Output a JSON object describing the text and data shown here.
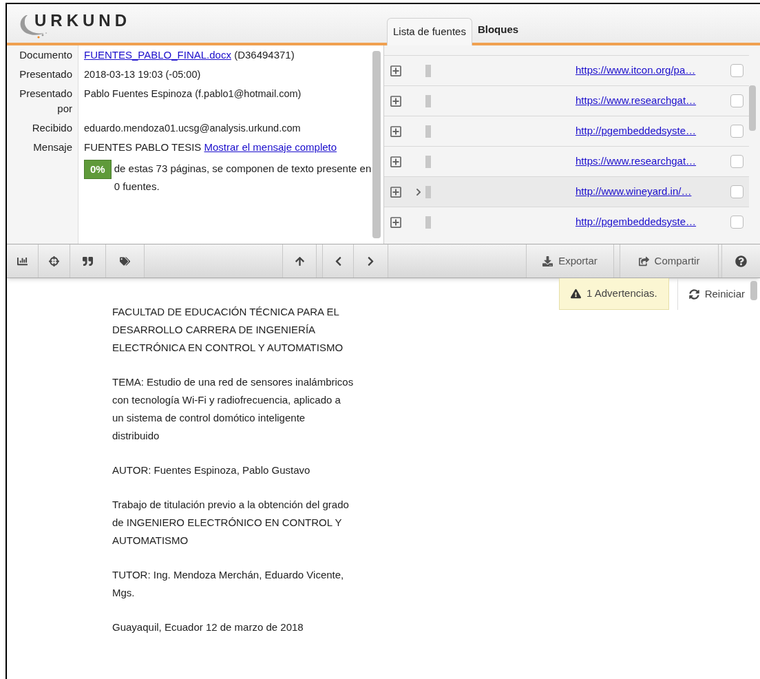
{
  "header": {
    "logo": "URKUND",
    "tabs": [
      {
        "label": "Lista de fuentes",
        "selected": true
      },
      {
        "label": "Bloques",
        "selected": false
      }
    ]
  },
  "details": [
    {
      "label": "Documento",
      "kind": "link",
      "link": "FUENTES_PABLO_FINAL.docx",
      "text": "(D36494371)"
    },
    {
      "label": "Presentado",
      "kind": "plain",
      "text": "2018-03-13 19:03 (-05:00)"
    },
    {
      "label": "Presentado por",
      "kind": "plain",
      "text": "Pablo Fuentes Espinoza (f.pablo1@hotmail.com)"
    },
    {
      "label": "Recibido",
      "kind": "plain",
      "text": "eduardo.mendoza01.ucsg@analysis.urkund.com"
    },
    {
      "label": "Mensaje",
      "kind": "message",
      "text": "FUENTES PABLO TESIS",
      "link": "Mostrar el mensaje completo"
    }
  ],
  "summary": {
    "badge": "0%",
    "text": "de estas 73 páginas, se componen de texto presente en 0 fuentes."
  },
  "sources": [
    {
      "url": "https://www.itcon.org/pa…",
      "selected": false,
      "checked": false
    },
    {
      "url": "https://www.researchgat…",
      "selected": false,
      "checked": false
    },
    {
      "url": "http://pgembeddedsyste…",
      "selected": false,
      "checked": false
    },
    {
      "url": "https://www.researchgat…",
      "selected": false,
      "checked": false
    },
    {
      "url": "http://www.wineyard.in/…",
      "selected": true,
      "checked": false
    },
    {
      "url": "http://pgembeddedsyste…",
      "selected": false,
      "checked": false
    }
  ],
  "toolbar": {
    "export": "Exportar",
    "share": "Compartir"
  },
  "warning": "1 Advertencias.",
  "reset": "Reiniciar",
  "document": [
    "FACULTAD DE EDUCACIÓN TÉCNICA PARA EL DESARROLLO CARRERA DE INGENIERÍA ELECTRÓNICA EN CONTROL Y AUTOMATISMO",
    "TEMA: Estudio de una red de sensores inalámbricos con tecnología Wi-Fi y radiofrecuencia, aplicado a un sistema de control domótico inteligente distribuido",
    "AUTOR: Fuentes Espinoza, Pablo Gustavo",
    "Trabajo de titulación previo a la obtención del grado de INGENIERO ELECTRÓNICO EN CONTROL Y AUTOMATISMO",
    "TUTOR: Ing. Mendoza Merchán, Eduardo Vicente, Mgs.",
    "Guayaquil, Ecuador 12 de marzo de 2018"
  ]
}
